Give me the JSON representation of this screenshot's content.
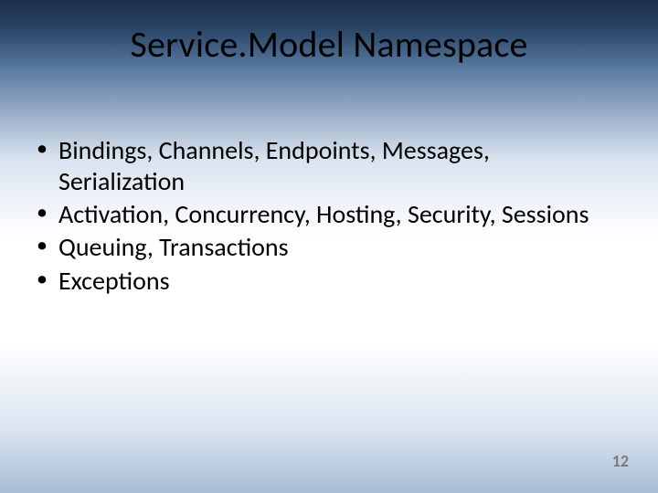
{
  "slide": {
    "title": "Service.Model Namespace",
    "bullets": [
      "Bindings, Channels, Endpoints, Messages, Serialization",
      "Activation, Concurrency, Hosting, Security, Sessions",
      "Queuing, Transactions",
      "Exceptions"
    ],
    "page_number": "12"
  }
}
